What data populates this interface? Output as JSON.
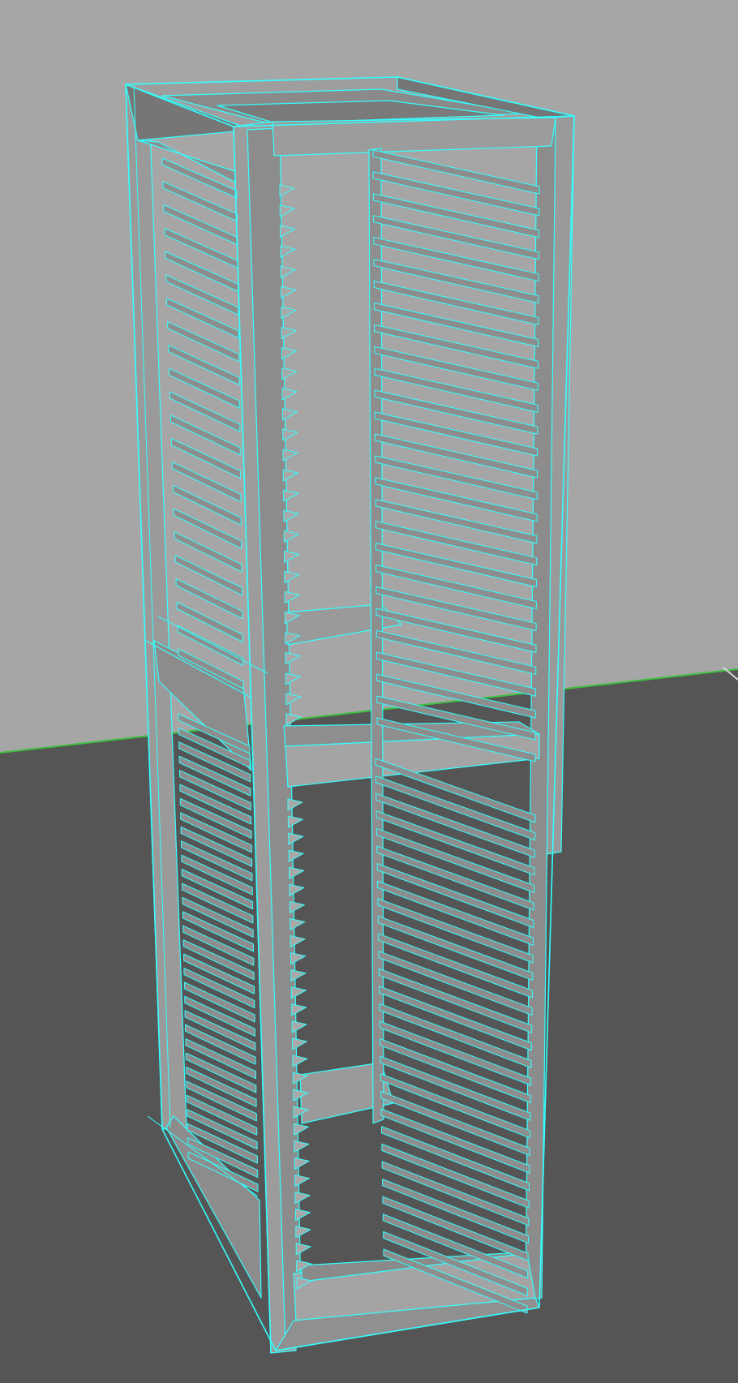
{
  "viewport": {
    "backdrop_color": "#a6a6a6",
    "floor_color": "#555555",
    "horizon_line_color": "#3fbf3f"
  },
  "model": {
    "object": "rack-frame",
    "selected": true,
    "wireframe_color": "#33ffff",
    "face_light_color": "#9a9a9a",
    "face_mid_color": "#8c8c8c",
    "face_dark_color": "#767676",
    "upper_bay_slot_count": 27,
    "lower_bay_slot_count": 29
  }
}
